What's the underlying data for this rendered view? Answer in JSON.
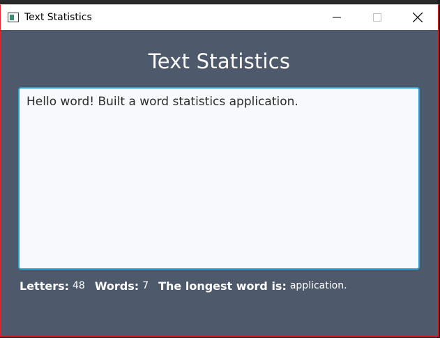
{
  "window": {
    "title": "Text Statistics",
    "minimize_icon": "minimize-icon",
    "maximize_icon": "maximize-icon",
    "close_icon": "close-icon",
    "app_icon": "app-icon"
  },
  "main": {
    "heading": "Text Statistics",
    "text_input": "Hello word! Built a word statistics application."
  },
  "stats": {
    "letters_label": "Letters:",
    "letters_value": "48",
    "words_label": "Words:",
    "words_value": "7",
    "longest_label": "The longest word is:",
    "longest_value": "application."
  },
  "colors": {
    "background": "#4e5a6c",
    "accent_border": "#2aa0d8",
    "text_area_bg": "#f7f9fc"
  }
}
